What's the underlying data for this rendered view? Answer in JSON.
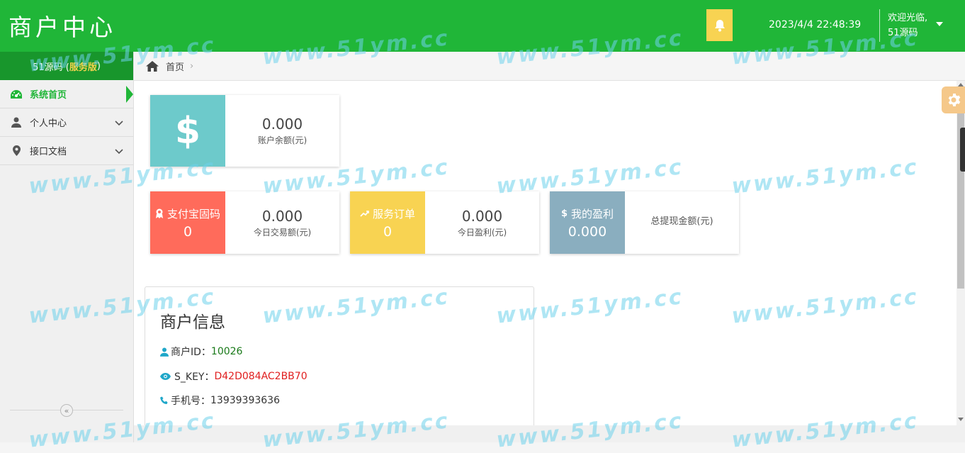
{
  "header": {
    "title": "商户中心",
    "datetime": "2023/4/4 22:48:39",
    "welcome_line1": "欢迎光临,",
    "welcome_line2": "51源码"
  },
  "sidebar": {
    "brand_prefix": "51源码 ( ",
    "brand_highlight": "服务版",
    "brand_suffix": " )",
    "items": [
      {
        "label": "系统首页",
        "icon": "dashboard-icon",
        "active": true
      },
      {
        "label": "个人中心",
        "icon": "user-icon",
        "active": false
      },
      {
        "label": "接口文档",
        "icon": "map-marker-icon",
        "active": false
      }
    ]
  },
  "breadcrumb": {
    "label": "首页"
  },
  "cards": {
    "balance": {
      "value": "0.000",
      "label": "账户余额(元)"
    },
    "alipay": {
      "title": "支付宝固码",
      "count": "0",
      "value": "0.000",
      "label": "今日交易额(元)"
    },
    "orders": {
      "title": "服务订单",
      "count": "0",
      "value": "0.000",
      "label": "今日盈利(元)"
    },
    "profit": {
      "title": "我的盈利",
      "amount": "0.000",
      "label": "总提现金额(元)"
    }
  },
  "merchant": {
    "title": "商户信息",
    "id_label": "商户ID：",
    "id_value": "10026",
    "skey_label": "S_KEY：",
    "skey_value": "D42D084AC2BB70",
    "phone_label": "手机号：",
    "phone_value": "13939393636"
  },
  "watermark": "www.51ym.cc",
  "colors": {
    "header_green": "#20b638",
    "teal": "#6dcacb",
    "coral": "#ff6b5b",
    "yellow": "#f8d352",
    "slate": "#8aaebf"
  }
}
